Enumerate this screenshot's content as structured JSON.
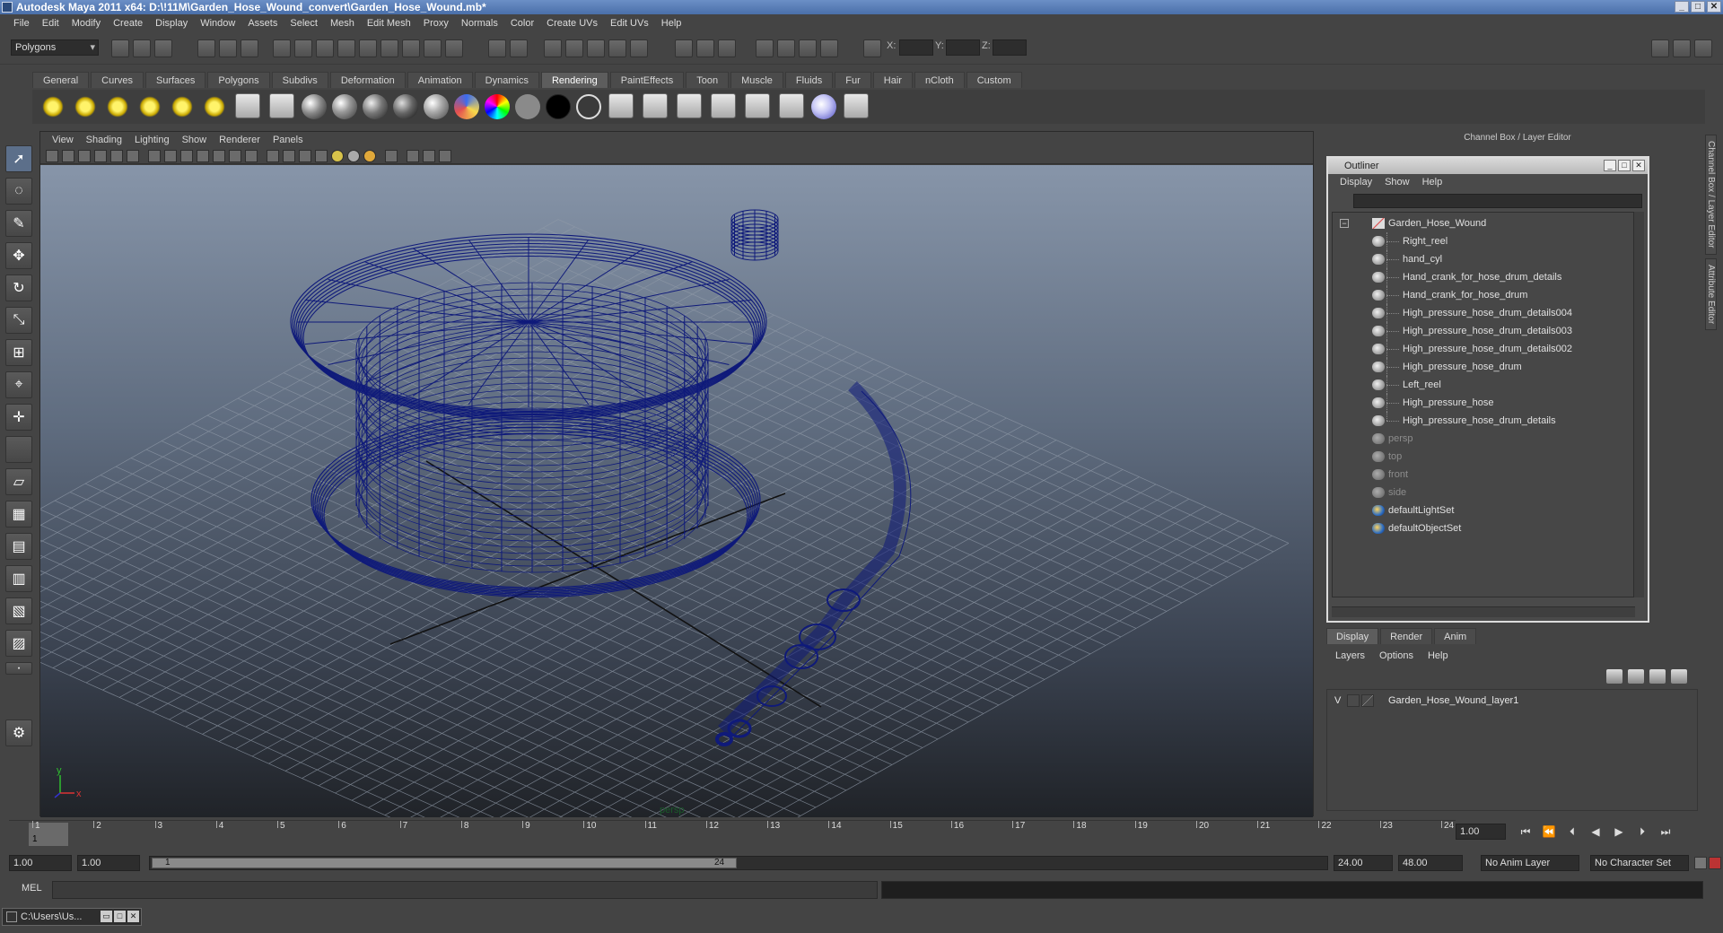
{
  "window": {
    "title": "Autodesk Maya 2011 x64: D:\\!11M\\Garden_Hose_Wound_convert\\Garden_Hose_Wound.mb*"
  },
  "menubar": [
    "File",
    "Edit",
    "Modify",
    "Create",
    "Display",
    "Window",
    "Assets",
    "Select",
    "Mesh",
    "Edit Mesh",
    "Proxy",
    "Normals",
    "Color",
    "Create UVs",
    "Edit UVs",
    "Help"
  ],
  "statusline": {
    "mode": "Polygons",
    "x_label": "X:",
    "y_label": "Y:",
    "z_label": "Z:"
  },
  "shelf": {
    "tabs": [
      "General",
      "Curves",
      "Surfaces",
      "Polygons",
      "Subdivs",
      "Deformation",
      "Animation",
      "Dynamics",
      "Rendering",
      "PaintEffects",
      "Toon",
      "Muscle",
      "Fluids",
      "Fur",
      "Hair",
      "nCloth",
      "Custom"
    ],
    "active_tab": "Rendering"
  },
  "viewport": {
    "menu": [
      "View",
      "Shading",
      "Lighting",
      "Show",
      "Renderer",
      "Panels"
    ],
    "camera_label": "persp",
    "axis_y": "y",
    "axis_x": "x",
    "wire_color": "#0f1a7a"
  },
  "channel_box": {
    "header": "Channel Box / Layer Editor"
  },
  "outliner": {
    "title": "Outliner",
    "menu": [
      "Display",
      "Show",
      "Help"
    ],
    "root": "Garden_Hose_Wound",
    "children": [
      "Right_reel",
      "hand_cyl",
      "Hand_crank_for_hose_drum_details",
      "Hand_crank_for_hose_drum",
      "High_pressure_hose_drum_details004",
      "High_pressure_hose_drum_details003",
      "High_pressure_hose_drum_details002",
      "High_pressure_hose_drum",
      "Left_reel",
      "High_pressure_hose",
      "High_pressure_hose_drum_details"
    ],
    "cameras": [
      "persp",
      "top",
      "front",
      "side"
    ],
    "sets": [
      "defaultLightSet",
      "defaultObjectSet"
    ]
  },
  "layer_editor": {
    "tabs": [
      "Display",
      "Render",
      "Anim"
    ],
    "active_tab": "Display",
    "menu": [
      "Layers",
      "Options",
      "Help"
    ],
    "layers": [
      {
        "visible": "V",
        "name": "Garden_Hose_Wound_layer1"
      }
    ]
  },
  "side_tabs": [
    "Channel Box / Layer Editor",
    "Attribute Editor"
  ],
  "timeline": {
    "ticks": [
      "1",
      "2",
      "3",
      "4",
      "5",
      "6",
      "7",
      "8",
      "9",
      "10",
      "11",
      "12",
      "13",
      "14",
      "15",
      "16",
      "17",
      "18",
      "19",
      "20",
      "21",
      "22",
      "23",
      "24"
    ],
    "current_frame": "1",
    "current_time": "1.00"
  },
  "range": {
    "start": "1.00",
    "playback_start": "1.00",
    "handle_start": "1",
    "handle_end": "24",
    "playback_end": "24.00",
    "end": "48.00",
    "anim_layer": "No Anim Layer",
    "character_set": "No Character Set"
  },
  "cmdline": {
    "label": "MEL"
  },
  "taskbar": {
    "item": "C:\\Users\\Us..."
  }
}
